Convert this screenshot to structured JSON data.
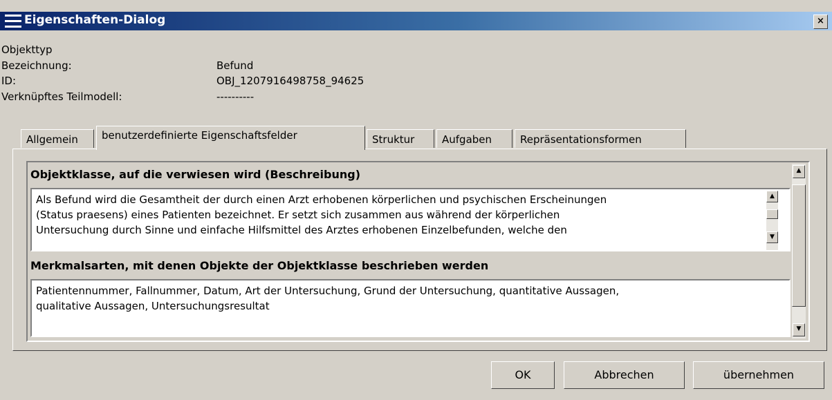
{
  "window": {
    "title": "Eigenschaften-Dialog",
    "close_label": "×"
  },
  "info": {
    "objekttyp_label": "Objekttyp",
    "bezeichnung_label": "Bezeichnung:",
    "bezeichnung_value": "Befund",
    "id_label": "ID:",
    "id_value": "OBJ_1207916498758_94625",
    "teilmodell_label": "Verknüpftes Teilmodell:",
    "teilmodell_value": "----------"
  },
  "tabs": [
    {
      "label": "Allgemein"
    },
    {
      "label": "benutzerdefinierte Eigenschaftsfelder"
    },
    {
      "label": "Struktur"
    },
    {
      "label": "Aufgaben"
    },
    {
      "label": "Repräsentationsformen"
    }
  ],
  "panel": {
    "section1_title": "Objektklasse, auf die verwiesen wird (Beschreibung)",
    "section1_lines": [
      "Als Befund wird die Gesamtheit der durch einen Arzt erhobenen körperlichen und psychischen Erscheinungen",
      "(Status praesens) eines Patienten bezeichnet. Er setzt sich zusammen aus während der körperlichen",
      "Untersuchung durch Sinne und einfache Hilfsmittel des Arztes erhobenen Einzelbefunden, welche den"
    ],
    "section2_title": "Merkmalsarten, mit denen Objekte der Objektklasse beschrieben werden",
    "section2_lines": [
      "Patientennummer, Fallnummer, Datum, Art der Untersuchung, Grund der Untersuchung, quantitative Aussagen,",
      "qualitative Aussagen, Untersuchungsresultat"
    ]
  },
  "buttons": {
    "ok": "OK",
    "cancel": "Abbrechen",
    "apply": "übernehmen"
  },
  "icons": {
    "menu": "menu-icon",
    "close": "close-icon",
    "scroll_up": "scroll-up-icon",
    "scroll_down": "scroll-down-icon"
  }
}
